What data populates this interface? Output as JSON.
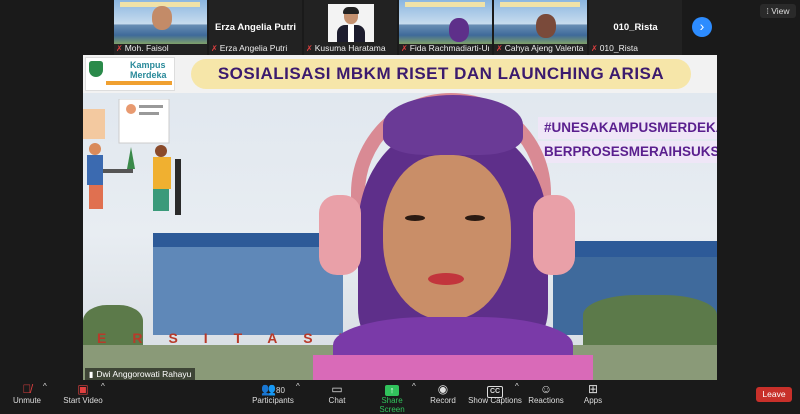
{
  "participants": [
    {
      "name": "Moh. Faisol",
      "muted": true,
      "display": "video"
    },
    {
      "name": "Erza Angelia Putri",
      "muted": true,
      "display": "name"
    },
    {
      "name": "Kusuma Haratama",
      "muted": true,
      "display": "photo"
    },
    {
      "name": "Fida Rachmadiarti-Un...",
      "muted": true,
      "display": "video"
    },
    {
      "name": "Cahya Ajeng Valenta ...",
      "muted": true,
      "display": "video"
    },
    {
      "name": "010_Rista",
      "muted": true,
      "display": "name"
    }
  ],
  "view_button": "View",
  "main_video": {
    "speaker_name": "Dwi Anggorowati Rahayu",
    "banner_title": "SOSIALISASI MBKM RISET DAN LAUNCHING ARISA",
    "logo_line1": "Kampus",
    "logo_line2": "Merdeka",
    "hashtag1": "#UNESAKAMPUSMERDEKA",
    "hashtag2": "BERPROSESMERAIHSUKS",
    "sign_letters": "ERSITASNE"
  },
  "toolbar": {
    "unmute": "Unmute",
    "start_video": "Start Video",
    "participants": "Participants",
    "participants_count": "80",
    "chat": "Chat",
    "share_screen": "Share Screen",
    "record": "Record",
    "captions_badge": "CC",
    "show_captions": "Show Captions",
    "reactions": "Reactions",
    "apps": "Apps",
    "leave": "Leave"
  },
  "colors": {
    "background": "#1a1a1a",
    "accent_blue": "#2d8cff",
    "share_green": "#31c35c",
    "leave_red": "#c8302a",
    "muted_red": "#e04040"
  }
}
